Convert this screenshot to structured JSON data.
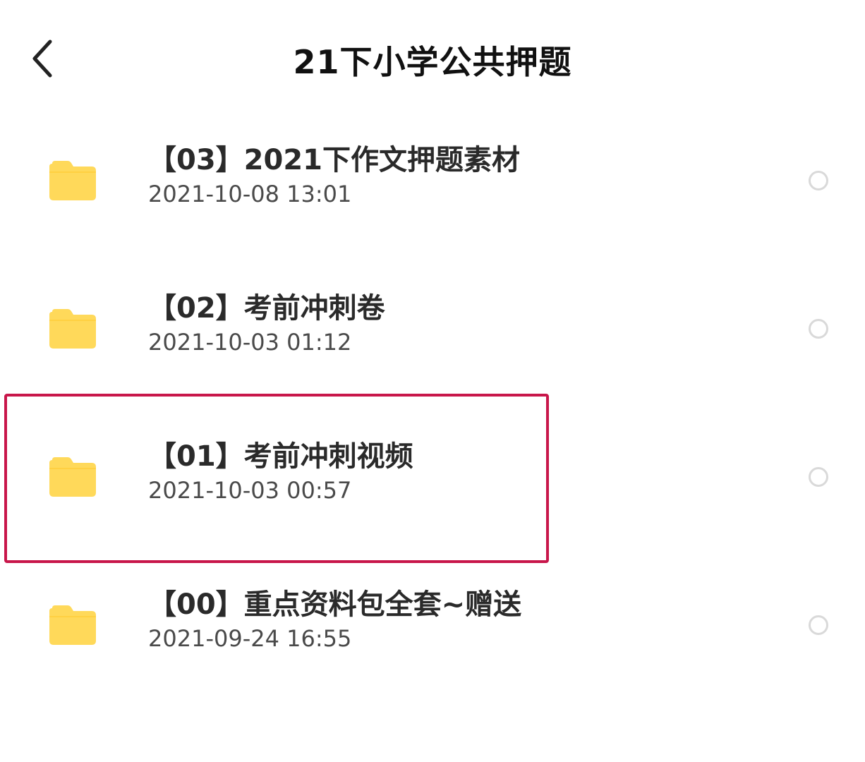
{
  "header": {
    "title": "21下小学公共押题",
    "back_icon": "chevron-left-icon"
  },
  "files": [
    {
      "name": "【03】2021下作文押题素材",
      "date": "2021-10-08 13:01",
      "icon": "folder-icon",
      "selected": false
    },
    {
      "name": "【02】考前冲刺卷",
      "date": "2021-10-03 01:12",
      "icon": "folder-icon",
      "selected": false
    },
    {
      "name": "【01】考前冲刺视频",
      "date": "2021-10-03 00:57",
      "icon": "folder-icon",
      "selected": false,
      "highlighted": true
    },
    {
      "name": "【00】重点资料包全套~赠送",
      "date": "2021-09-24 16:55",
      "icon": "folder-icon",
      "selected": false
    }
  ],
  "colors": {
    "folder": "#FFD95A",
    "highlight_border": "#C8164A",
    "radio_border": "#D9D9D9",
    "title": "#111111",
    "date": "#4A4A4A"
  }
}
